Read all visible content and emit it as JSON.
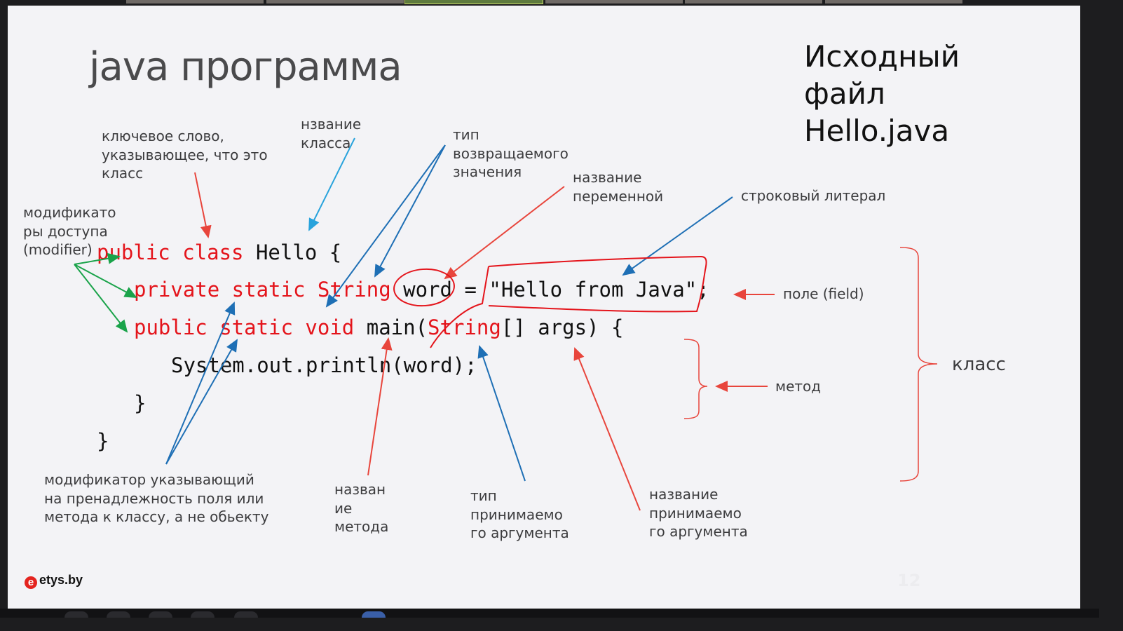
{
  "slide": {
    "title": "java программа",
    "source_file": [
      "Исходный",
      "файл",
      "Hello.java"
    ],
    "page_number": "12",
    "logo_text": "etys.by",
    "logo_mark": "e"
  },
  "code": {
    "line1": {
      "kw": "public class",
      "rest": " Hello {"
    },
    "line2": {
      "kw1": "private static",
      "type": "String",
      "name": "word",
      "eq": " = ",
      "literal": "\"Hello from Java\"",
      "end": ";"
    },
    "line3": {
      "kw": "public static void",
      "method": " main(",
      "argtype": "String",
      "rest": "[] args) {"
    },
    "line4": "System.out.println(word);",
    "line5": "}",
    "line6": "}"
  },
  "annotations": {
    "class_keyword": "ключевое слово,\nуказывающее, что это\nкласс",
    "class_name": "нзвание\nкласса",
    "return_type": "тип\nвозвращаемого\nзначения",
    "variable_name": "название\nпеременной",
    "string_literal": "строковый литерал",
    "access_modifiers": "модификато\nры доступа\n(modifier)",
    "field": "поле (field)",
    "method": "метод",
    "class": "класс",
    "static_modifier": "модификатор указывающий\nна пренадлежность поля или\nметода к классу, а не обьекту",
    "method_name": "назван\nие\nметода",
    "arg_type": "тип\nпринимаемо\nго аргумента",
    "arg_name": "название\nпринимаемо\nго аргумента"
  },
  "colors": {
    "keyword": "#e4141b",
    "red_arrow": "#e8453c",
    "blue_arrow": "#1e6fb5",
    "light_blue_arrow": "#29a3dc",
    "green_arrow": "#1aa34a"
  }
}
